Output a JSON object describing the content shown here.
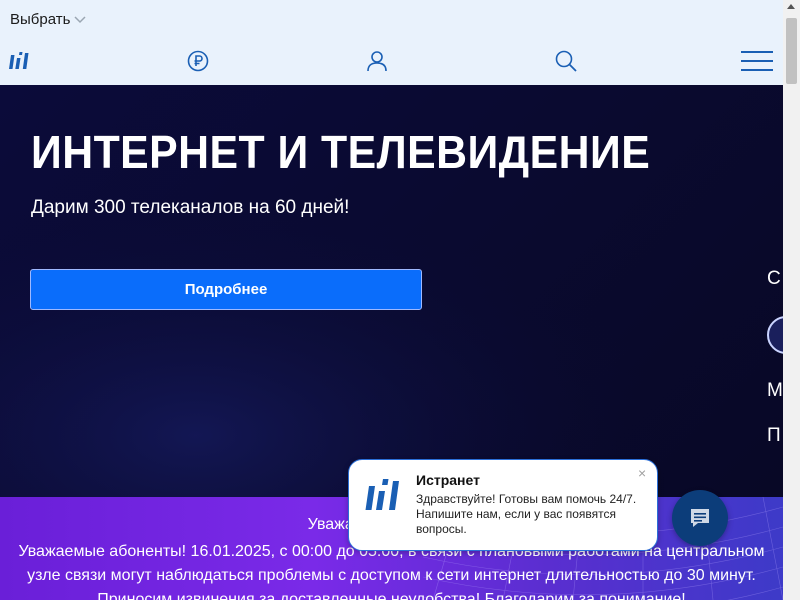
{
  "header": {
    "language_label": "Выбрать",
    "icons": [
      "logo-icon",
      "ruble-icon",
      "user-icon",
      "search-icon",
      "menu-icon"
    ]
  },
  "hero": {
    "title": "ИНТЕРНЕТ И ТЕЛЕВИДЕНИЕ",
    "subtitle": "Дарим 300 телеканалов на 60 дней!",
    "button_label": "Подробнее",
    "side_c": "С",
    "side_m": "М",
    "side_p": "П"
  },
  "notice": {
    "heading": "Уважаемые абоненты!",
    "text": "Уважаемые абоненты! 16.01.2025, с 00:00 до 05:00, в связи с плановыми работами на центральном узле связи могут наблюдаться проблемы с доступом к сети интернет длительностью до 30 минут. Приносим извинения за доставленные неудобства! Благодарим за понимание!"
  },
  "chat": {
    "name": "Истранет",
    "message": "Здравствуйте! Готовы вам помочь 24/7. Напишите нам, если у вас появятся вопросы.",
    "close_label": "×"
  },
  "colors": {
    "brand_blue": "#1a5fb4",
    "button_blue": "#0a6dfb",
    "hero_bg": "#0a0a30",
    "notice_purple": "#7a2ae8",
    "chat_button": "#0c3d7a"
  }
}
